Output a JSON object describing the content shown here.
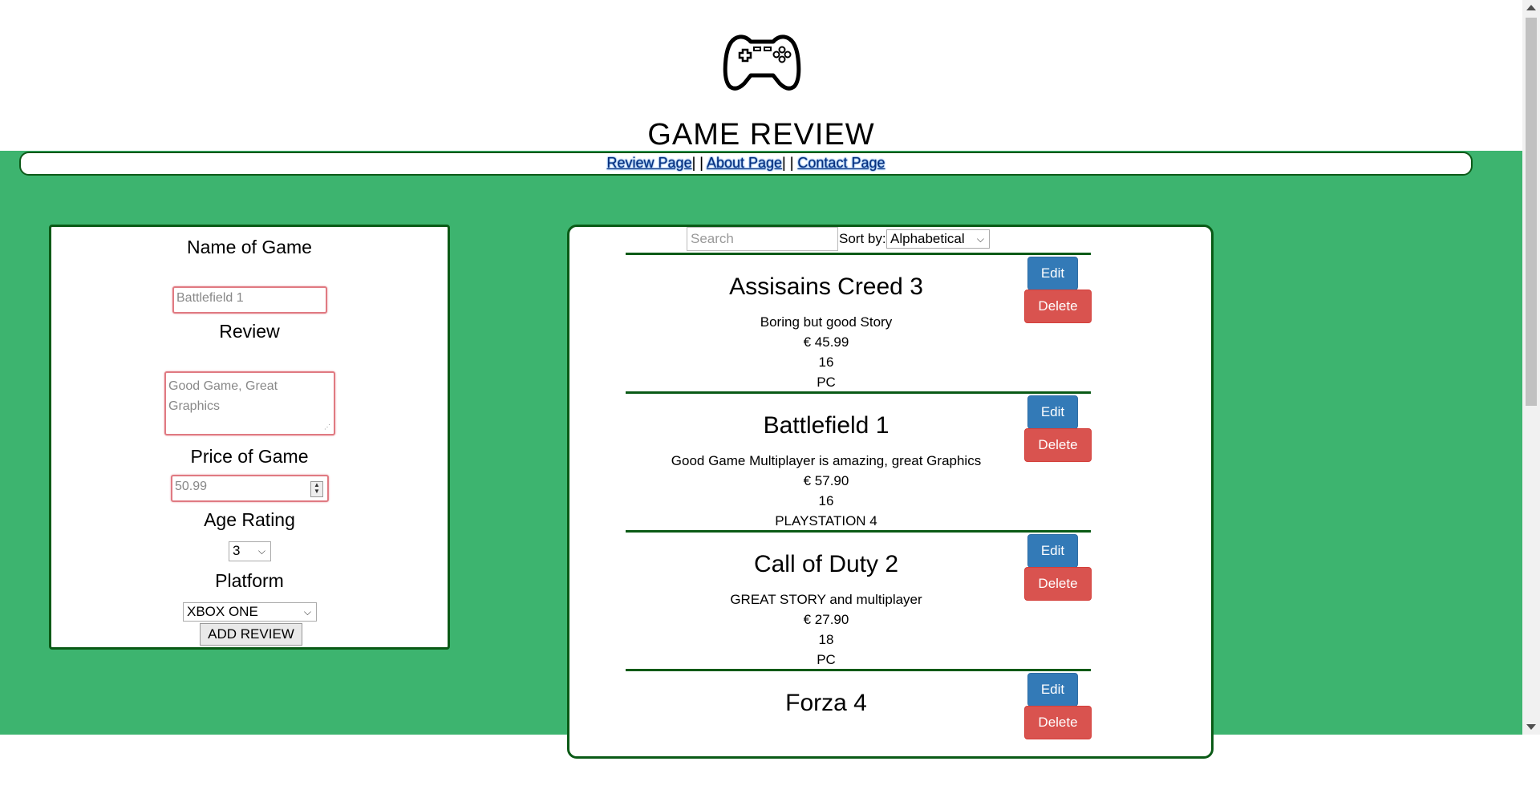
{
  "header": {
    "title": "GAME REVIEW",
    "logo_icon": "gamepad-icon"
  },
  "nav": {
    "items": [
      "Review Page",
      "About Page",
      "Contact Page"
    ],
    "separator": "| |"
  },
  "form": {
    "name_label": "Name of Game",
    "name_placeholder": "Battlefield 1",
    "review_label": "Review",
    "review_placeholder": "Good Game, Great Graphics",
    "price_label": "Price of Game",
    "price_placeholder": "50.99",
    "age_label": "Age Rating",
    "age_value": "3",
    "platform_label": "Platform",
    "platform_value": "XBOX ONE",
    "submit_label": "ADD REVIEW"
  },
  "list": {
    "search_placeholder": "Search",
    "sort_label": "Sort by:",
    "sort_value": "Alphabetical",
    "edit_label": "Edit",
    "delete_label": "Delete",
    "reviews": [
      {
        "title": "Assisains Creed 3",
        "review": "Boring but good Story",
        "price": "€ 45.99",
        "age": "16",
        "platform": "PC"
      },
      {
        "title": "Battlefield 1",
        "review": "Good Game Multiplayer is amazing, great Graphics",
        "price": "€ 57.90",
        "age": "16",
        "platform": "PLAYSTATION 4"
      },
      {
        "title": "Call of Duty 2",
        "review": "GREAT STORY and multiplayer",
        "price": "€ 27.90",
        "age": "18",
        "platform": "PC"
      },
      {
        "title": "Forza 4",
        "review": "",
        "price": "",
        "age": "",
        "platform": ""
      }
    ]
  },
  "colors": {
    "background": "#3db46f",
    "border": "#0a5a16",
    "edit": "#337ab7",
    "delete": "#d9534f"
  }
}
